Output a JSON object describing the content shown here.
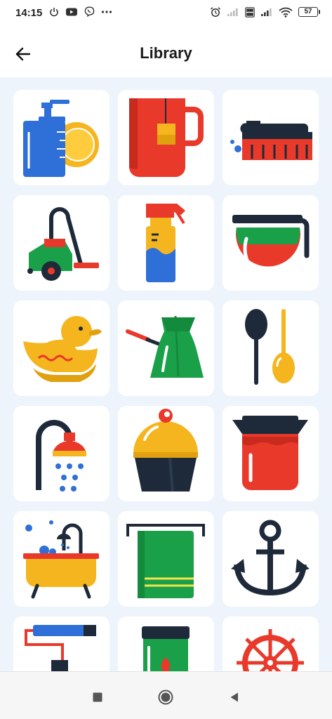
{
  "status_bar": {
    "time": "14:15",
    "left_icons": [
      "power-icon",
      "youtube-icon",
      "viber-icon",
      "more-dots-icon"
    ],
    "right_icons": [
      "alarm-icon",
      "signal-weak-icon",
      "volte-icon",
      "signal-icon",
      "wifi-icon"
    ],
    "battery": "57"
  },
  "app_bar": {
    "title": "Library",
    "back_icon": "arrow-left-icon"
  },
  "library": {
    "items": [
      {
        "icon": "dish-soap-plate-icon"
      },
      {
        "icon": "tea-mug-icon"
      },
      {
        "icon": "scrub-brush-icon"
      },
      {
        "icon": "vacuum-cleaner-icon"
      },
      {
        "icon": "spray-bottle-icon"
      },
      {
        "icon": "coffee-pot-icon"
      },
      {
        "icon": "rubber-duck-icon"
      },
      {
        "icon": "coffee-cezve-icon"
      },
      {
        "icon": "spoons-icon"
      },
      {
        "icon": "shower-head-icon"
      },
      {
        "icon": "cupcake-icon"
      },
      {
        "icon": "jam-jar-icon"
      },
      {
        "icon": "bathtub-icon"
      },
      {
        "icon": "towel-icon"
      },
      {
        "icon": "anchor-icon"
      },
      {
        "icon": "paint-roller-icon"
      },
      {
        "icon": "jar-icon"
      },
      {
        "icon": "ship-wheel-icon"
      }
    ]
  },
  "nav_bar": {
    "buttons": [
      "recents-square-icon",
      "home-circle-icon",
      "back-triangle-icon"
    ]
  },
  "colors": {
    "grid_background": "#eef4fb",
    "tile_background": "#ffffff",
    "red": "#e8392b",
    "yellow": "#f5b51e",
    "blue": "#2f6fd8",
    "green": "#1aa049",
    "navy": "#1e2a3a"
  }
}
